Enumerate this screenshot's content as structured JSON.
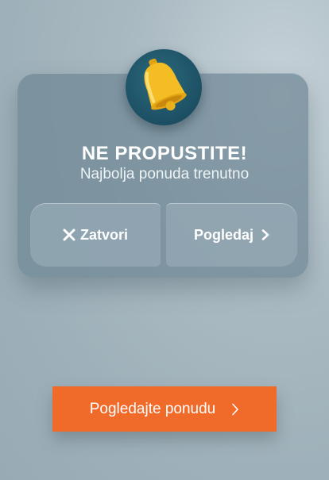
{
  "popup": {
    "title": "NE PROPUSTITE!",
    "subtitle": "Najbolja ponuda trenutno",
    "icon": "bell-icon",
    "close_label": "Zatvori",
    "view_label": "Pogledaj"
  },
  "cta": {
    "label": "Pogledajte ponudu"
  },
  "colors": {
    "accent": "#f06a2a",
    "bell": "#f2b81e",
    "badge": "#1d4f63"
  }
}
